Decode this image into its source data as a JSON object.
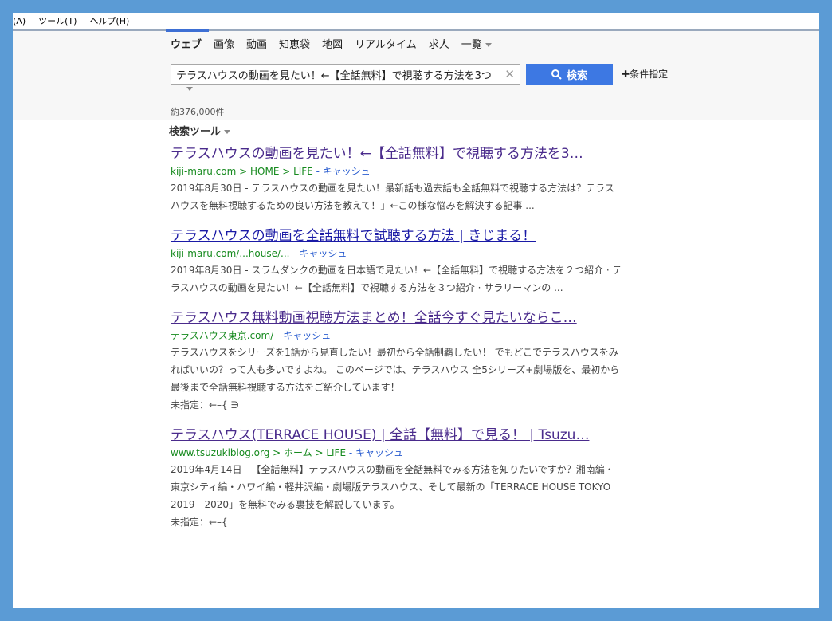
{
  "menu": {
    "items": [
      "(A)",
      "ツール(T)",
      "ヘルプ(H)"
    ]
  },
  "tabs": {
    "items": [
      "ウェブ",
      "画像",
      "動画",
      "知恵袋",
      "地図",
      "リアルタイム",
      "求人",
      "一覧"
    ]
  },
  "search": {
    "value": "テラスハウスの動画を見たい！←【全話無料】で視聴する方法を3つ",
    "button": "検索",
    "advanced": "条件指定"
  },
  "results_count": "約376,000件",
  "tools_label": "検索ツール",
  "results": [
    {
      "title": "テラスハウスの動画を見たい！←【全話無料】で視聴する方法を3…",
      "url": "kiji-maru.com > HOME > LIFE",
      "cache": " - キャッシュ",
      "snippet": "2019年8月30日 - テラスハウスの動画を見たい！最新話も過去話も全話無料で視聴する方法は？テラス ハウスを無料視聴するための良い方法を教えて！」←この様な悩みを解決する記事 ...",
      "visited": true
    },
    {
      "title": "テラスハウスの動画を全話無料で試聴する方法 | きじまる！",
      "url": "kiji-maru.com/...house/...",
      "cache": " - キャッシュ",
      "snippet": "2019年8月30日 - スラムダンクの動画を日本語で見たい！←【全話無料】で視聴する方法を２つ紹介 · テラスハウスの動画を見たい！←【全話無料】で視聴する方法を３つ紹介 · サラリーマンの ...",
      "visited": false
    },
    {
      "title": "テラスハウス無料動画視聴方法まとめ！全話今すぐ見たいならこ…",
      "url": "テラスハウス東京.com/",
      "cache": " - キャッシュ",
      "snippet": "テラスハウスをシリーズを1話から見直したい！最初から全話制覇したい！ でもどこでテラスハウスをみればいいの？って人も多いですよね。 このページでは、テラスハウス 全5シリーズ+劇場版を、最初から最後まで全話無料視聴する方法をご紹介しています！",
      "extra": "未指定：←–{ ∋",
      "visited": true
    },
    {
      "title": "テラスハウス(TERRACE HOUSE) | 全話【無料】で見る！ | Tsuzu…",
      "url": "www.tsuzukiblog.org > ホーム > LIFE",
      "cache": " - キャッシュ",
      "snippet": "2019年4月14日 - 【全話無料】テラスハウスの動画を全話無料でみる方法を知りたいですか？湘南編・ 東京シティ編・ハワイ編・軽井沢編・劇場版テラスハウス、そして最新の「TERRACE HOUSE TOKYO 2019 - 2020」を無料でみる裏技を解説しています。",
      "extra": "未指定：←–{",
      "visited": true
    }
  ]
}
